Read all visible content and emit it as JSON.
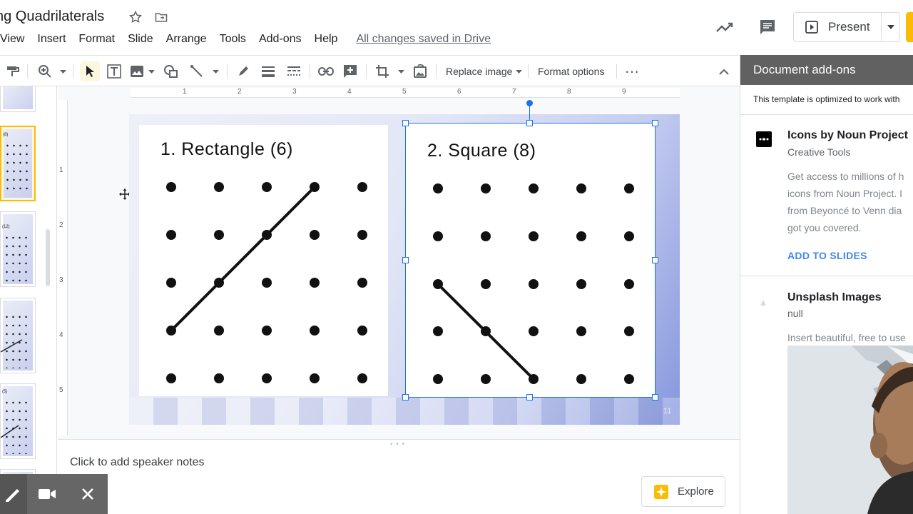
{
  "doc": {
    "title": "ng Quadrilaterals",
    "saved_status": "All changes saved in Drive"
  },
  "menu": [
    "View",
    "Insert",
    "Format",
    "Slide",
    "Arrange",
    "Tools",
    "Add-ons",
    "Help"
  ],
  "header_actions": {
    "present_label": "Present"
  },
  "toolbar": {
    "replace_image_label": "Replace image",
    "format_options_label": "Format options",
    "more_label": "⋯"
  },
  "ruler": {
    "horizontal": [
      "1",
      "2",
      "3",
      "4",
      "5",
      "6",
      "7",
      "8",
      "9"
    ],
    "vertical": [
      "1",
      "2",
      "3",
      "4",
      "5"
    ]
  },
  "slide": {
    "panel1_title": "1.  Rectangle (6)",
    "panel2_title": "2.  Square (8)",
    "slide_number": "11"
  },
  "notes": {
    "placeholder": "Click to add speaker notes",
    "explore_label": "Explore"
  },
  "side_panel": {
    "header": "Document add-ons",
    "subtitle": "This template is optimized to work with",
    "addons": [
      {
        "name": "Icons by Noun Project",
        "category": "Creative Tools",
        "description": [
          "Get access to millions of h",
          "icons from Noun Project. I",
          "from Beyoncé to Venn dia",
          "got you covered."
        ],
        "action": "ADD TO SLIDES"
      },
      {
        "name": "Unsplash Images",
        "category": "null",
        "description": [
          "Insert beautiful, free to use"
        ]
      }
    ]
  },
  "thumbs": {
    "label1": "(8)",
    "label2": "(12)",
    "label3": "(5)"
  }
}
